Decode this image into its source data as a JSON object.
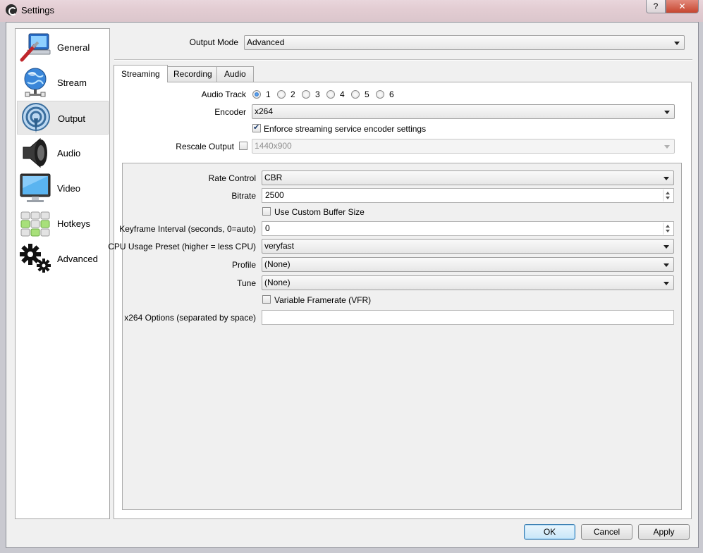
{
  "window": {
    "title": "Settings",
    "help_label": "?",
    "close_label": "✕"
  },
  "sidebar": {
    "items": [
      {
        "label": "General",
        "icon": "general-icon"
      },
      {
        "label": "Stream",
        "icon": "stream-icon"
      },
      {
        "label": "Output",
        "icon": "output-icon"
      },
      {
        "label": "Audio",
        "icon": "audio-icon"
      },
      {
        "label": "Video",
        "icon": "video-icon"
      },
      {
        "label": "Hotkeys",
        "icon": "hotkeys-icon"
      },
      {
        "label": "Advanced",
        "icon": "advanced-icon"
      }
    ],
    "selected": "Output"
  },
  "output_mode": {
    "label": "Output Mode",
    "value": "Advanced"
  },
  "tabs": [
    {
      "label": "Streaming",
      "active": true
    },
    {
      "label": "Recording",
      "active": false
    },
    {
      "label": "Audio",
      "active": false
    }
  ],
  "streaming": {
    "audio_track": {
      "label": "Audio Track",
      "options": [
        "1",
        "2",
        "3",
        "4",
        "5",
        "6"
      ],
      "selected": "1"
    },
    "encoder": {
      "label": "Encoder",
      "value": "x264"
    },
    "enforce": {
      "label": "Enforce streaming service encoder settings",
      "checked": true
    },
    "rescale": {
      "label": "Rescale Output",
      "checked": false,
      "value": "1440x900"
    },
    "rate_control": {
      "label": "Rate Control",
      "value": "CBR"
    },
    "bitrate": {
      "label": "Bitrate",
      "value": "2500"
    },
    "custom_buffer": {
      "label": "Use Custom Buffer Size",
      "checked": false
    },
    "keyframe": {
      "label": "Keyframe Interval (seconds, 0=auto)",
      "value": "0"
    },
    "cpu_preset": {
      "label": "CPU Usage Preset (higher = less CPU)",
      "value": "veryfast"
    },
    "profile": {
      "label": "Profile",
      "value": "(None)"
    },
    "tune": {
      "label": "Tune",
      "value": "(None)"
    },
    "vfr": {
      "label": "Variable Framerate (VFR)",
      "checked": false
    },
    "x264_options": {
      "label": "x264 Options (separated by space)",
      "value": ""
    }
  },
  "buttons": {
    "ok": "OK",
    "cancel": "Cancel",
    "apply": "Apply"
  },
  "colors": {
    "accent": "#3c7fb1",
    "titlebar": "#e3cdd3",
    "close": "#c7452f"
  }
}
